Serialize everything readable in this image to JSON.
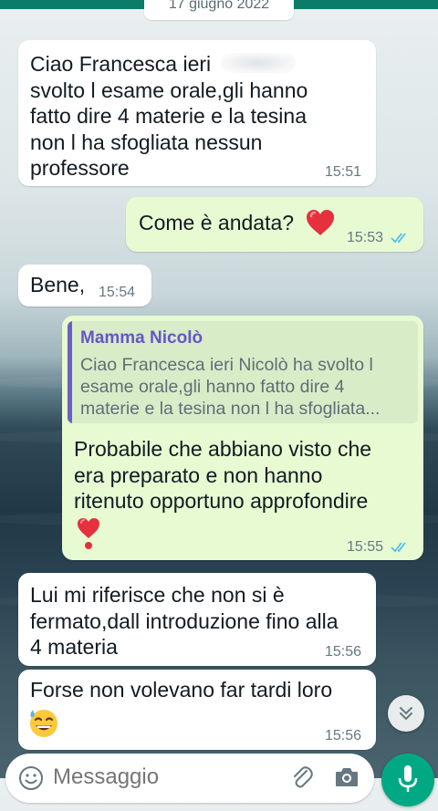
{
  "date_divider": "17 giugno 2022",
  "messages": [
    {
      "direction": "incoming",
      "text": "Ciao Francesca ieri         ha\nsvolto l esame orale,gli hanno\nfatto dire 4 materie e la tesina\nnon l ha sfogliata nessun\nprofessore",
      "time": "15:51"
    },
    {
      "direction": "outgoing",
      "text": "Come è andata?",
      "emoji": "red-heart",
      "time": "15:53",
      "status": "read"
    },
    {
      "direction": "incoming",
      "text": "Bene,",
      "time": "15:54"
    },
    {
      "direction": "outgoing",
      "quoted": {
        "author": "Mamma  Nicolò",
        "text": "Ciao Francesca ieri Nicolò ha svolto l\nesame orale,gli hanno fatto dire 4\nmaterie e la tesina non l ha sfogliata..."
      },
      "text": "Probabile che abbiano visto che\nera preparato e non hanno\nritenuto opportuno approfondire",
      "emoji": "heart-exclamation",
      "time": "15:55",
      "status": "read"
    },
    {
      "direction": "incoming",
      "text": "Lui mi riferisce che non si è\nfermato,dall introduzione fino alla\n4 materia",
      "time": "15:56"
    },
    {
      "direction": "incoming",
      "text": "Forse non volevano far tardi loro",
      "emoji": "grinning-face-with-sweat",
      "time": "15:56"
    }
  ],
  "composer": {
    "placeholder": "Messaggio"
  },
  "icons": {
    "scroll_down": "double-chevron-down-icon",
    "emoji_button": "smiley-icon",
    "attach": "paperclip-icon",
    "camera": "camera-icon",
    "mic": "microphone-icon"
  },
  "colors": {
    "incoming_bubble": "#ffffff",
    "outgoing_bubble": "#e7fad2",
    "read_ticks": "#53bdeb",
    "quote_author": "#6656c9",
    "accent": "#00a884"
  }
}
